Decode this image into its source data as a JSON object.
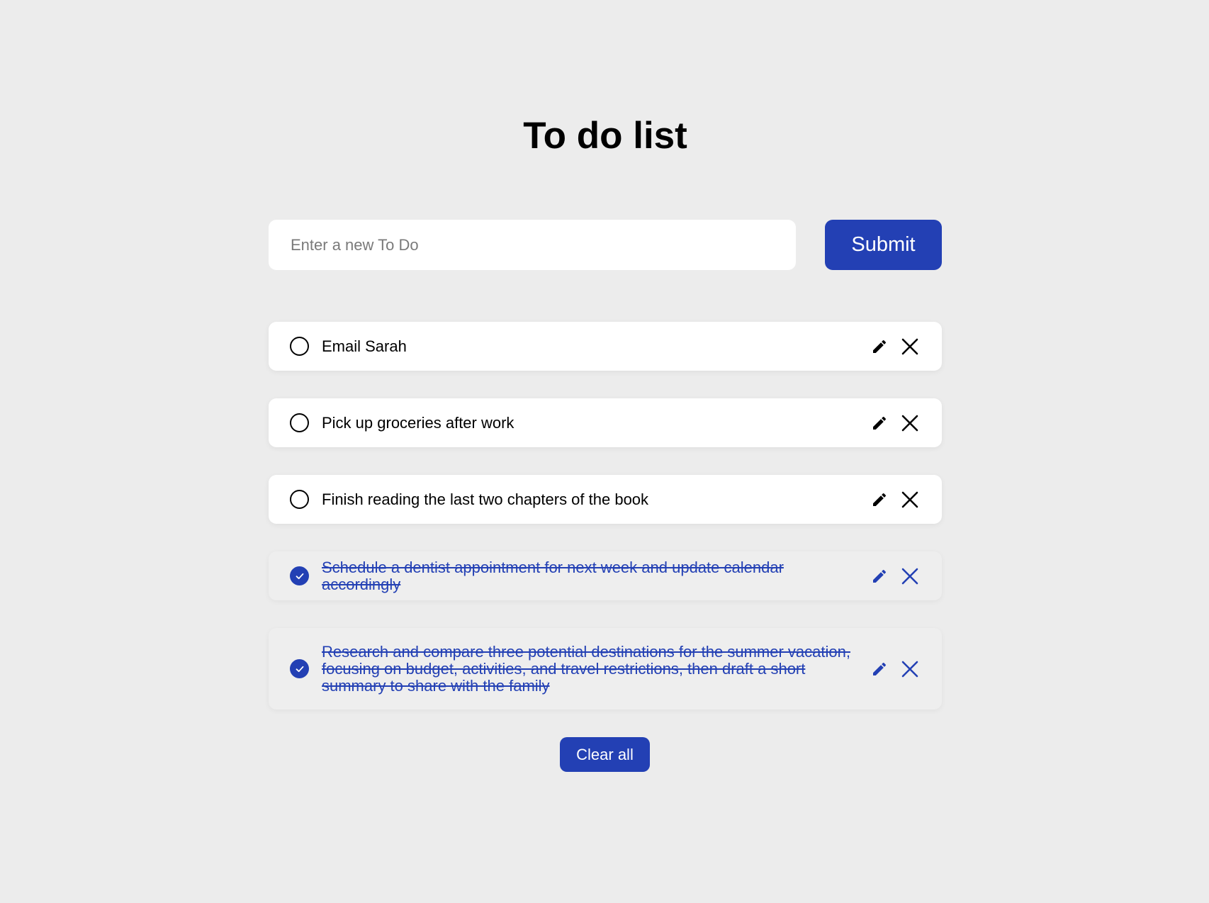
{
  "page": {
    "title": "To do list"
  },
  "form": {
    "placeholder": "Enter a new To Do",
    "submit_label": "Submit"
  },
  "todos": [
    {
      "text": "Email Sarah",
      "completed": false
    },
    {
      "text": "Pick up groceries after work",
      "completed": false
    },
    {
      "text": "Finish reading the last two chapters of the book",
      "completed": false
    },
    {
      "text": "Schedule a dentist appointment for next week and update calendar accordingly",
      "completed": true
    },
    {
      "text": "Research and compare three potential destinations for the summer vacation, focusing on budget, activities, and travel restrictions, then draft a short summary to share with the family",
      "completed": true
    }
  ],
  "actions": {
    "clear_all_label": "Clear all"
  },
  "icons": {
    "edit": "pencil-icon",
    "delete": "close-icon",
    "checked": "check-icon"
  },
  "colors": {
    "background": "#ececec",
    "accent": "#2340b4",
    "card": "#ffffff",
    "card_done": "#eeeeee"
  }
}
